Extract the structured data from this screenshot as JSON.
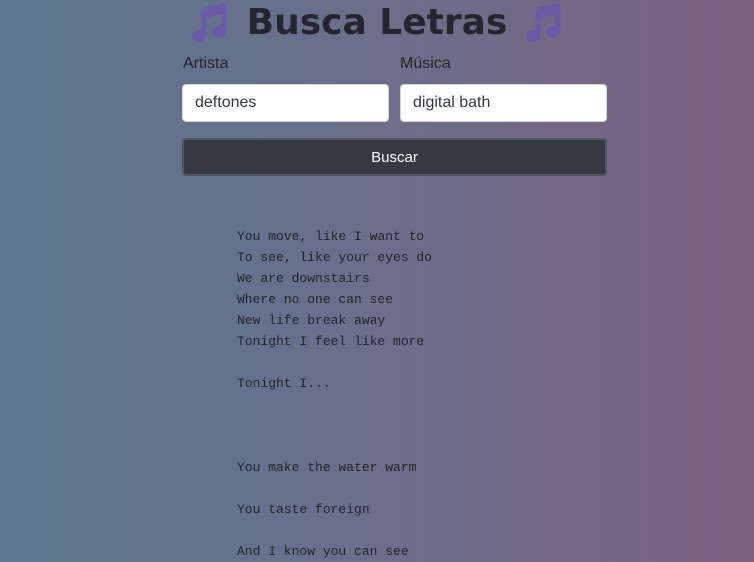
{
  "header": {
    "title": "Busca Letras",
    "left_icon": "music-note-icon",
    "right_icon": "music-note-icon",
    "icon_color": "#6a5aa8"
  },
  "form": {
    "artist_label": "Artista",
    "artist_value": "deftones",
    "song_label": "Música",
    "song_value": "digital bath",
    "search_label": "Buscar"
  },
  "lyrics": {
    "lines": [
      "You move, like I want to",
      "To see, like your eyes do",
      "We are downstairs",
      "Where no one can see",
      "New life break away",
      "Tonight I feel like more",
      "",
      "Tonight I...",
      "",
      "",
      "",
      "You make the water warm",
      "",
      "You taste foreign",
      "",
      "And I know you can see"
    ]
  },
  "colors": {
    "gradient_left": "#5d7790",
    "gradient_right": "#7c6281",
    "button_bg": "#343a40",
    "title_color": "#25252f"
  }
}
